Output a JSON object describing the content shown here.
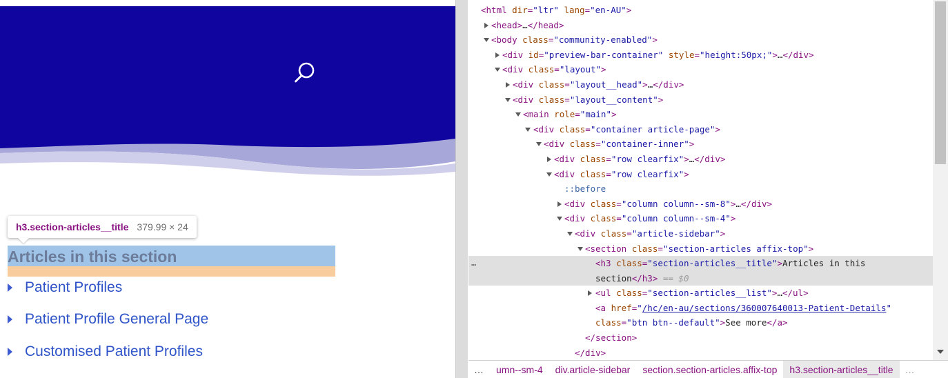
{
  "page": {
    "tooltip": {
      "selector": "h3.section-articles__title",
      "dimensions": "379.99 × 24"
    },
    "section_title": "Articles in this section",
    "articles": [
      "Patient Profiles",
      "Patient Profile General Page",
      "Customised Patient Profiles"
    ],
    "colors": {
      "hero": "#10069f",
      "wave_light": "#d0cfeb",
      "wave_mid": "#a8a7d9",
      "link": "#2f54c8"
    }
  },
  "devtools": {
    "lines": [
      [
        "<html dir=\"ltr\" lang=\"en-AU\">"
      ],
      [
        "<head>…</head>"
      ],
      [
        "<body class=\"community-enabled\">"
      ],
      [
        "<div id=\"preview-bar-container\" style=\"height:50px;\">…</div>"
      ],
      [
        "<div class=\"layout\">"
      ],
      [
        "<div class=\"layout__head\">…</div>"
      ],
      [
        "<div class=\"layout__content\">"
      ],
      [
        "<main role=\"main\">"
      ],
      [
        "<div class=\"container article-page\">"
      ],
      [
        "<div class=\"container-inner\">"
      ],
      [
        "<div class=\"row clearfix\">…</div>"
      ],
      [
        "<div class=\"row clearfix\">"
      ],
      [
        "::before"
      ],
      [
        "<div class=\"column column--sm-8\">…</div>"
      ],
      [
        "<div class=\"column column--sm-4\">"
      ],
      [
        "<div class=\"article-sidebar\">"
      ],
      [
        "<section class=\"section-articles affix-top\">"
      ],
      [
        "<h3 class=\"section-articles__title\">Articles in this",
        "section</h3> == $0"
      ],
      [
        "<ul class=\"section-articles__list\">…</ul>"
      ],
      [
        "<a href=\"/hc/en-au/sections/360007640013-Patient-Details\"",
        "class=\"btn btn--default\">See more</a>"
      ],
      [
        "</section>"
      ],
      [
        "</div>"
      ]
    ],
    "gutter_ellipsis": "…",
    "breadcrumbs": {
      "more_left": "…",
      "items": [
        "umn--sm-4",
        "div.article-sidebar",
        "section.section-articles.affix-top",
        "h3.section-articles__title"
      ],
      "more_right": "…"
    }
  }
}
